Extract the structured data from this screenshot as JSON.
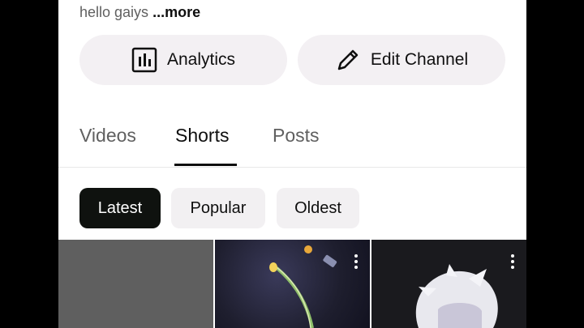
{
  "channel": {
    "description": "hello gaiys",
    "more_label": "...more"
  },
  "actions": {
    "analytics_label": "Analytics",
    "edit_label": "Edit Channel"
  },
  "tabs": [
    {
      "label": "Videos"
    },
    {
      "label": "Shorts",
      "selected": true
    },
    {
      "label": "Posts"
    }
  ],
  "filters": [
    {
      "label": "Latest",
      "selected": true
    },
    {
      "label": "Popular"
    },
    {
      "label": "Oldest"
    }
  ],
  "icons": {
    "analytics": "analytics-icon",
    "edit": "pencil-icon",
    "more": "more-vertical-icon"
  },
  "colors": {
    "selected_chip_bg": "#0f120f",
    "chip_bg": "#f2f0f2",
    "button_bg": "#f3f0f3"
  }
}
